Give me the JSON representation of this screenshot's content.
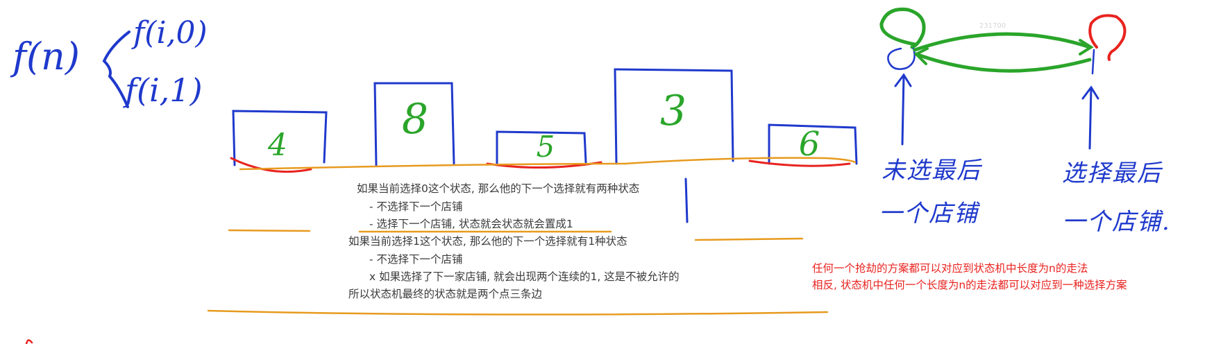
{
  "formula": {
    "main": "f(n)",
    "branch_top": "f(i,0)",
    "branch_bottom": "f(i,1)"
  },
  "shops": [
    {
      "value": "4"
    },
    {
      "value": "8"
    },
    {
      "value": "5"
    },
    {
      "value": "3"
    },
    {
      "value": "6"
    }
  ],
  "notes": [
    "如果当前选择0这个状态, 那么他的下一个选择就有两种状态",
    "- 不选择下一个店铺",
    "- 选择下一个店铺, 状态就会状态就会置成1",
    "如果当前选择1这个状态, 那么他的下一个选择就有1种状态",
    "- 不选择下一个店铺",
    "x 如果选择了下一家店铺, 就会出现两个连续的1, 这是不被允许的",
    "所以状态机最终的状态就是两个点三条边"
  ],
  "state_machine": {
    "watermark": "231700",
    "left_caption_line1": "未选最后",
    "left_caption_line2": "一个店铺",
    "right_caption_line1": "选择最后",
    "right_caption_line2": "一个店铺."
  },
  "red_notes": [
    "任何一个抢劫的方案都可以对应到状态机中长度为n的走法",
    "相反, 状态机中任何一个长度为n的走法都可以对应到一种选择方案"
  ],
  "colors": {
    "ink_blue": "#1f39cc",
    "ink_green": "#2aa52a",
    "ink_red": "#e8231f",
    "ink_orange": "#e79a1e",
    "text_gray": "#3a3a3a"
  }
}
